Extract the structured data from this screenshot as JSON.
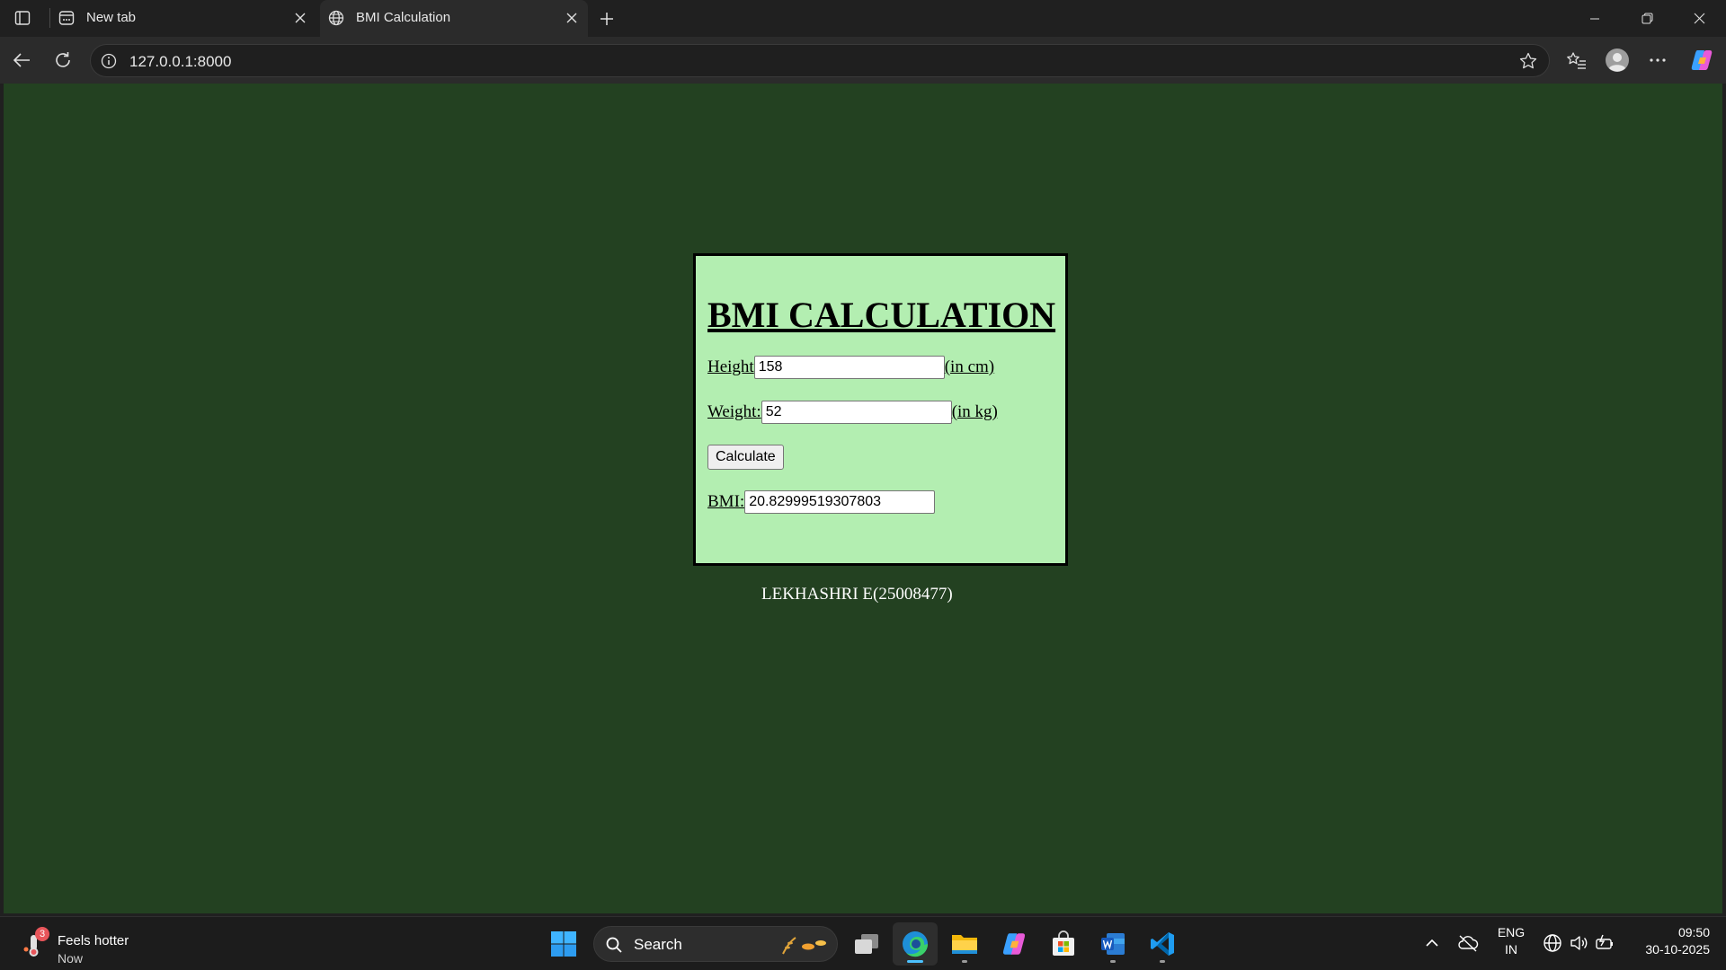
{
  "browser": {
    "tabs": [
      {
        "title": "New tab",
        "favicon": "new-tab-page-icon"
      },
      {
        "title": "BMI Calculation",
        "favicon": "globe-icon",
        "active": true
      }
    ],
    "url": "127.0.0.1:8000"
  },
  "page": {
    "background": "#234121",
    "card_background": "#b3eeb1",
    "title": "BMI CALCULATION",
    "height": {
      "label": "Height",
      "value": "158",
      "unit": "(in cm)"
    },
    "weight": {
      "label": "Weight:",
      "value": "52",
      "unit": "(in kg)"
    },
    "calculate_label": "Calculate",
    "bmi": {
      "label": "BMI:",
      "value": "20.82999519307803"
    },
    "footer": "LEKHASHRI E(25008477)"
  },
  "taskbar": {
    "weather": {
      "badge": "3",
      "line1": "Feels hotter",
      "line2": "Now"
    },
    "search_label": "Search",
    "apps": [
      "start-icon",
      "task-view-icon",
      "edge-icon",
      "file-explorer-icon",
      "copilot-icon",
      "store-icon",
      "word-icon",
      "vscode-icon"
    ],
    "language": {
      "line1": "ENG",
      "line2": "IN"
    },
    "clock": {
      "time": "09:50",
      "date": "30-10-2025"
    }
  }
}
